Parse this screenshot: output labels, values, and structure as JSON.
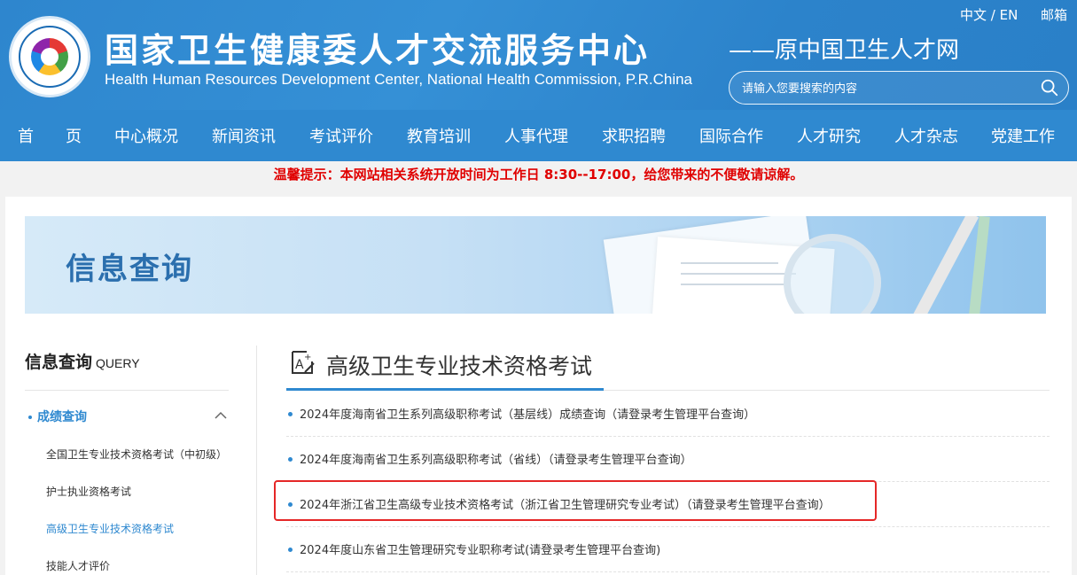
{
  "header": {
    "title": "国家卫生健康委人才交流服务中心",
    "subtitle": "Health Human Resources Development Center, National Health Commission, P.R.China",
    "slogan": "——原中国卫生人才网",
    "lang_zh": "中文",
    "lang_sep": " / ",
    "lang_en": "EN",
    "mail": "邮箱",
    "search_placeholder": "请输入您要搜索的内容",
    "logo_icon": "emblem-logo-icon"
  },
  "nav": [
    {
      "label": "首　　页"
    },
    {
      "label": "中心概况"
    },
    {
      "label": "新闻资讯"
    },
    {
      "label": "考试评价"
    },
    {
      "label": "教育培训"
    },
    {
      "label": "人事代理"
    },
    {
      "label": "求职招聘"
    },
    {
      "label": "国际合作"
    },
    {
      "label": "人才研究"
    },
    {
      "label": "人才杂志"
    },
    {
      "label": "党建工作"
    }
  ],
  "notice": "温馨提示：本网站相关系统开放时间为工作日 8:30--17:00，给您带来的不便敬请谅解。",
  "banner": {
    "title": "信息查询"
  },
  "sidebar": {
    "title": "信息查询",
    "title_en": "QUERY",
    "active_group": "成绩查询",
    "items": [
      {
        "label": "全国卫生专业技术资格考试（中初级）"
      },
      {
        "label": "护士执业资格考试"
      },
      {
        "label": "高级卫生专业技术资格考试"
      },
      {
        "label": "技能人才评价"
      }
    ]
  },
  "main": {
    "section_title": "高级卫生专业技术资格考试",
    "items": [
      {
        "text": "2024年度海南省卫生系列高级职称考试（基层线）成绩查询（请登录考生管理平台查询）"
      },
      {
        "text": "2024年度海南省卫生系列高级职称考试（省线）（请登录考生管理平台查询）"
      },
      {
        "text": "2024年浙江省卫生高级专业技术资格考试（浙江省卫生管理研究专业考试）（请登录考生管理平台查询）"
      },
      {
        "text": "2024年度山东省卫生管理研究专业职称考试(请登录考生管理平台查询)"
      }
    ]
  },
  "colors": {
    "brand_blue": "#2f89d0",
    "notice_red": "#e00000",
    "highlight_red": "#e52727"
  }
}
